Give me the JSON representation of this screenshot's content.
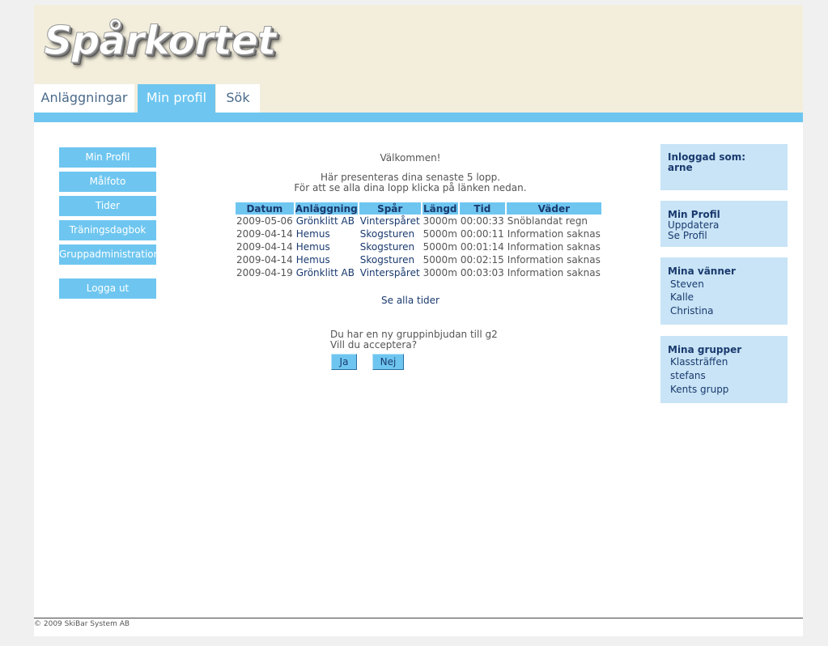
{
  "header": {
    "logo_text": "Spårkortet",
    "tabs": [
      {
        "label": "Anläggningar"
      },
      {
        "label": "Min profil"
      },
      {
        "label": "Sök"
      }
    ]
  },
  "sidebar": {
    "items": [
      {
        "label": "Min Profil"
      },
      {
        "label": "Målfoto"
      },
      {
        "label": "Tider"
      },
      {
        "label": "Träningsdagbok"
      },
      {
        "label": "Gruppadministration"
      }
    ],
    "logout_label": "Logga ut"
  },
  "main": {
    "welcome": "Välkommen!",
    "intro_line1": "Här presenteras dina senaste 5 lopp.",
    "intro_line2": "För att se alla dina lopp klicka på länken nedan.",
    "table": {
      "headers": [
        "Datum",
        "Anläggning",
        "Spår",
        "Längd",
        "Tid",
        "Väder"
      ],
      "rows": [
        [
          "2009-05-06",
          "Grönklitt AB",
          "Vinterspåret",
          "3000m",
          "00:00:33",
          "Snöblandat regn"
        ],
        [
          "2009-04-14",
          "Hemus",
          "Skogsturen",
          "5000m",
          "00:00:11",
          "Information saknas"
        ],
        [
          "2009-04-14",
          "Hemus",
          "Skogsturen",
          "5000m",
          "00:01:14",
          "Information saknas"
        ],
        [
          "2009-04-14",
          "Hemus",
          "Skogsturen",
          "5000m",
          "00:02:15",
          "Information saknas"
        ],
        [
          "2009-04-19",
          "Grönklitt AB",
          "Vinterspåret",
          "3000m",
          "00:03:03",
          "Information saknas"
        ]
      ]
    },
    "see_all_link": "Se alla tider",
    "invite_line1": "Du har en ny gruppinbjudan till g2",
    "invite_line2": "Vill du acceptera?",
    "yes_label": "Ja",
    "no_label": "Nej"
  },
  "right": {
    "login": {
      "heading": "Inloggad som:",
      "user": "arne"
    },
    "profile": {
      "heading": "Min Profil",
      "links": [
        "Uppdatera",
        "Se Profil"
      ]
    },
    "friends": {
      "heading": "Mina vänner",
      "items": [
        "Steven",
        "Kalle",
        "Christina"
      ]
    },
    "groups": {
      "heading": "Mina grupper",
      "items": [
        "Klassträffen",
        "stefans",
        "Kents grupp"
      ]
    }
  },
  "footer": {
    "text": "© 2009 SkiBar System AB"
  },
  "colors": {
    "accent": "#6ec6f0",
    "header_bg": "#f3eedc",
    "box_bg": "#c8e4f6",
    "link": "#1a3a6e"
  }
}
